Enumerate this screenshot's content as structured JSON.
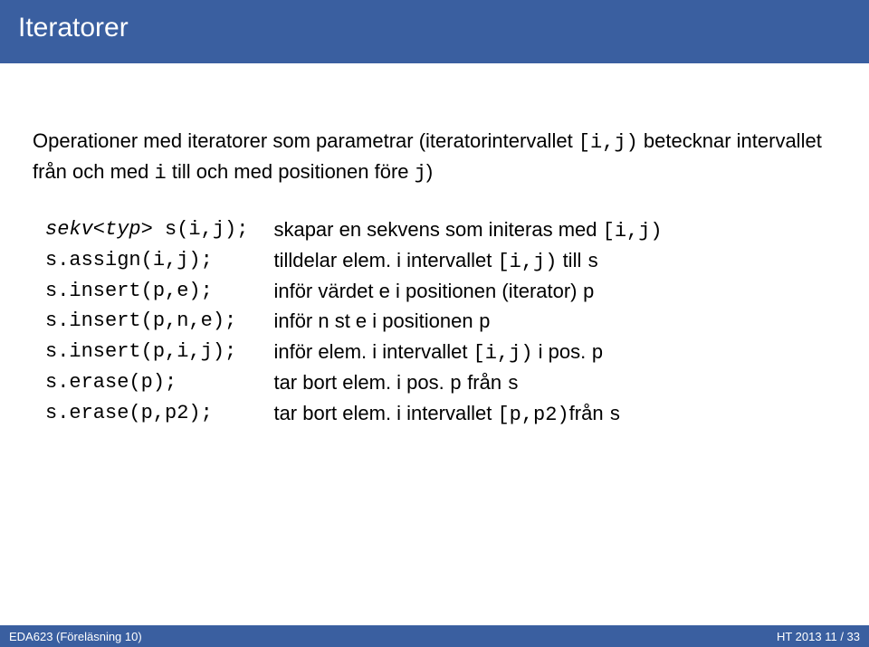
{
  "title": "Iteratorer",
  "intro": {
    "part1": "Operationer med iteratorer som parametrar (iteratorintervallet ",
    "code1": "[i,j)",
    "part2": " betecknar intervallet från och med ",
    "code2": "i",
    "part3": " till och med positionen före ",
    "code3": "j",
    "part4": ")"
  },
  "rows": [
    {
      "left_pre": "sekv<typ>",
      "left_post": " s(i,j);",
      "desc_a": "skapar en sekvens som initeras med ",
      "desc_code1": "[i,j)",
      "desc_b": "",
      "desc_code2": "",
      "desc_c": ""
    },
    {
      "left_pre": "",
      "left_post": "s.assign(i,j);",
      "desc_a": "tilldelar elem. i intervallet ",
      "desc_code1": "[i,j)",
      "desc_b": " till ",
      "desc_code2": "s",
      "desc_c": ""
    },
    {
      "left_pre": "",
      "left_post": "s.insert(p,e);",
      "desc_a": "inför värdet e i positionen (iterator) ",
      "desc_code1": "p",
      "desc_b": "",
      "desc_code2": "",
      "desc_c": ""
    },
    {
      "left_pre": "",
      "left_post": "s.insert(p,n,e);",
      "desc_a": "inför n st e i positionen ",
      "desc_code1": "p",
      "desc_b": "",
      "desc_code2": "",
      "desc_c": ""
    },
    {
      "left_pre": "",
      "left_post": "s.insert(p,i,j);",
      "desc_a": "inför elem. i intervallet ",
      "desc_code1": "[i,j)",
      "desc_b": " i pos. ",
      "desc_code2": "p",
      "desc_c": ""
    },
    {
      "left_pre": "",
      "left_post": "s.erase(p);",
      "desc_a": "tar bort elem. i pos. ",
      "desc_code1": "p",
      "desc_b": " från ",
      "desc_code2": "s",
      "desc_c": ""
    },
    {
      "left_pre": "",
      "left_post": "s.erase(p,p2);",
      "desc_a": "tar bort elem. i intervallet ",
      "desc_code1": "[p,p2)",
      "desc_b": "från ",
      "desc_code2": "s",
      "desc_c": ""
    }
  ],
  "footer": {
    "left": "EDA623 (Föreläsning 10)",
    "right": "HT 2013     11 / 33"
  }
}
